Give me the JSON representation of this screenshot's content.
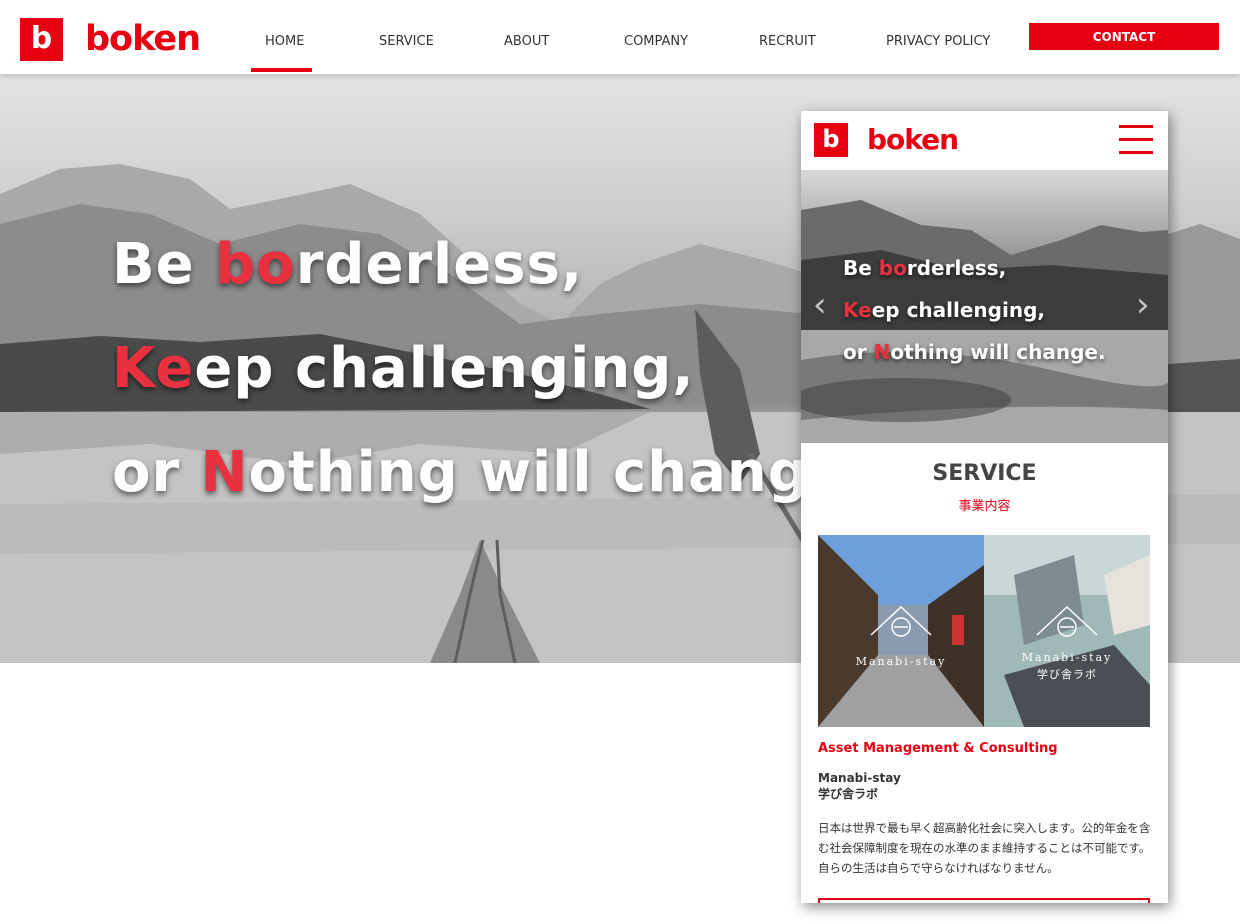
{
  "brand": {
    "logo_letter": "b",
    "logo_word": "boken",
    "accent_color": "#e60012"
  },
  "nav": {
    "items": [
      {
        "label": "HOME",
        "active": true
      },
      {
        "label": "SERVICE",
        "active": false
      },
      {
        "label": "ABOUT",
        "active": false
      },
      {
        "label": "COMPANY",
        "active": false
      },
      {
        "label": "RECRUIT",
        "active": false
      },
      {
        "label": "PRIVACY POLICY",
        "active": false
      }
    ],
    "contact_label": "CONTACT"
  },
  "hero": {
    "lines": [
      {
        "pre": "Be ",
        "hl": "bo",
        "post": "rderless,"
      },
      {
        "pre": "",
        "hl": "Ke",
        "post": "ep challenging,"
      },
      {
        "pre": "or ",
        "hl": "N",
        "post": "othing will change."
      }
    ]
  },
  "mobile": {
    "menu_icon": "hamburger-icon",
    "arrows": {
      "prev": "‹",
      "next": "›"
    },
    "section_title": "SERVICE",
    "section_subtitle": "事業内容",
    "cards": [
      {
        "label": "Manabi-stay"
      },
      {
        "label": "Manabi-stay",
        "sublabel": "学び舎ラボ"
      }
    ],
    "service_heading": "Asset Management & Consulting",
    "service_name_en": "Manabi-stay",
    "service_name_jp": "学び舎ラボ",
    "description": "日本は世界で最も早く超高齢化社会に突入します。公的年金を含む社会保障制度を現在の水準のまま維持することは不可能です。自らの生活は自らで守らなければなりません。"
  }
}
